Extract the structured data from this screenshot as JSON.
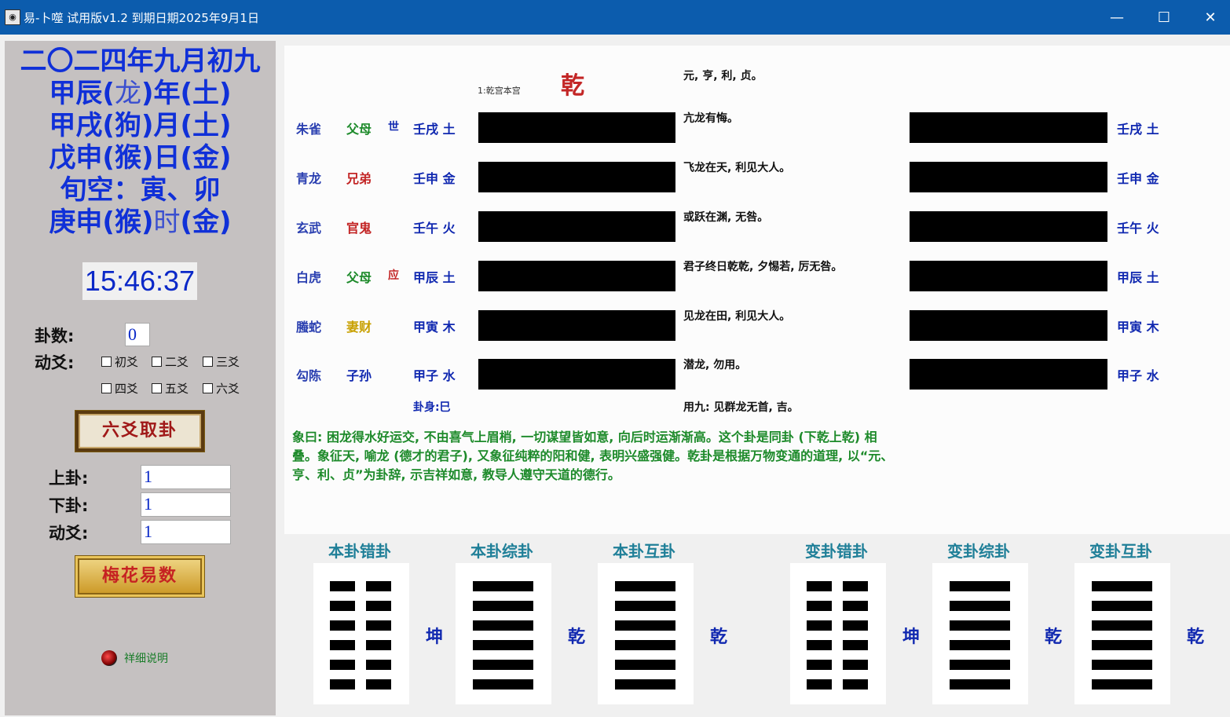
{
  "window": {
    "title": "易-卜噬  试用版v1.2 到期日期2025年9月1日",
    "icon": "eye-icon",
    "controls": [
      "minimize-icon",
      "maximize-icon",
      "close-icon"
    ]
  },
  "calendar": {
    "line1": "二〇二四年九月初九",
    "line2a": "甲辰(",
    "line2b": "龙",
    "line2c": ")年(土)",
    "line3": "甲戌(狗)月(土)",
    "line4": "戊申(猴)日(金)",
    "line5": "旬空：寅、卯",
    "line6a": "庚申(猴)",
    "line6b": "时",
    "line6c": "(金)"
  },
  "clock": "15:46:37",
  "controls": {
    "gua_count_label": "卦数:",
    "gua_count_value": "0",
    "moving_label": "动爻:",
    "yao_checks": [
      "初爻",
      "二爻",
      "三爻",
      "四爻",
      "五爻",
      "六爻"
    ],
    "liuyao_button": "六爻取卦",
    "upper_label": "上卦:",
    "upper_value": "1",
    "lower_label": "下卦:",
    "lower_value": "1",
    "move_label": "动爻:",
    "move_value": "1",
    "meihua_button": "梅花易数",
    "help_link": "祥细说明"
  },
  "hexagram": {
    "index_label": "1:乾宫本宫",
    "name": "乾",
    "judgment": "元, 亨, 利, 贞。",
    "lines": [
      {
        "spirit": "朱雀",
        "relation": "父母",
        "mark": "世",
        "stem": "壬戌 土",
        "text": "亢龙有悔。",
        "changed": "壬戌 土"
      },
      {
        "spirit": "青龙",
        "relation": "兄弟",
        "mark": "",
        "stem": "壬申 金",
        "text": "飞龙在天, 利见大人。",
        "changed": "壬申 金"
      },
      {
        "spirit": "玄武",
        "relation": "官鬼",
        "mark": "",
        "stem": "壬午 火",
        "text": "或跃在渊, 无咎。",
        "changed": "壬午 火"
      },
      {
        "spirit": "白虎",
        "relation": "父母",
        "mark": "应",
        "stem": "甲辰 土",
        "text": "君子终日乾乾, 夕惕若, 厉无咎。",
        "changed": "甲辰 土"
      },
      {
        "spirit": "螣蛇",
        "relation": "妻财",
        "mark": "",
        "stem": "甲寅 木",
        "text": "见龙在田, 利见大人。",
        "changed": "甲寅 木"
      },
      {
        "spirit": "勾陈",
        "relation": "子孙",
        "mark": "",
        "stem": "甲子 水",
        "text": "潜龙, 勿用。",
        "changed": "甲子 水"
      }
    ],
    "body_label": "卦身:巳",
    "yongjiu": "用九: 见群龙无首, 吉。",
    "commentary": "象曰: 困龙得水好运交, 不由喜气上眉梢, 一切谋望皆如意, 向后时运渐渐高。这个卦是同卦 (下乾上乾) 相叠。象征天, 喻龙 (德才的君子), 又象征纯粹的阳和健, 表明兴盛强健。乾卦是根据万物变通的道理, 以“元、亨、利、贞”为卦辞, 示吉祥如意, 教导人遵守天道的德行。"
  },
  "related": [
    {
      "title": "本卦错卦",
      "name": "坤",
      "type": "broken"
    },
    {
      "title": "本卦综卦",
      "name": "乾",
      "type": "solid"
    },
    {
      "title": "本卦互卦",
      "name": "乾",
      "type": "solid"
    },
    {
      "title": "变卦错卦",
      "name": "坤",
      "type": "broken"
    },
    {
      "title": "变卦综卦",
      "name": "乾",
      "type": "solid"
    },
    {
      "title": "变卦互卦",
      "name": "乾",
      "type": "solid"
    }
  ],
  "colors": {
    "titlebar": "#0c5cad",
    "calendar_text": "#1030d8",
    "hexagram_name": "#c32626",
    "commentary": "#1d8a2a",
    "trigram_title": "#1f7f98"
  }
}
